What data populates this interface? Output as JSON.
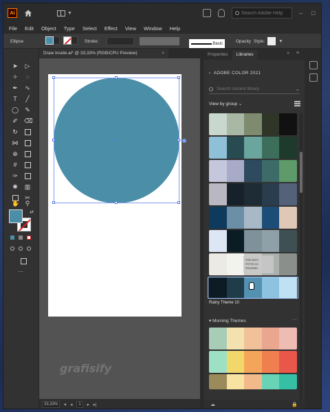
{
  "app": {
    "logo_text": "Ai"
  },
  "titlebar": {
    "search_placeholder": "Search Adobe Help"
  },
  "menu": [
    "File",
    "Edit",
    "Object",
    "Type",
    "Select",
    "Effect",
    "View",
    "Window",
    "Help"
  ],
  "controlbar": {
    "object_type": "Ellipse",
    "stroke_label": "Stroke:",
    "brush_label": "Basic",
    "opacity_label": "Opacity",
    "style_label": "Style:",
    "fill_color": "#4a8ea8"
  },
  "document": {
    "tab_title": "Draw Inside.ai* @ 33,33% (RGB/CPU Preview)",
    "close_glyph": "×"
  },
  "canvas": {
    "shape_color": "#4a8ea8",
    "watermark": "grafisify"
  },
  "statusbar": {
    "zoom": "33,33%",
    "artboard_number": "1"
  },
  "panel": {
    "tabs": [
      "Properties",
      "Libraries"
    ],
    "active_tab": "Libraries",
    "library_name": "ADOBE COLOR 2021",
    "search_placeholder": "Search current library",
    "view_by": "View by group",
    "themes": [
      {
        "colors": [
          "#c9d8cf",
          "#a8b8a5",
          "#7f8b6f",
          "#2f3527",
          "#111111"
        ]
      },
      {
        "colors": [
          "#8ec0d8",
          "#284b52",
          "#6aa69d",
          "#3d6e5c",
          "#1e3a2c"
        ]
      },
      {
        "colors": [
          "#c5c8dc",
          "#a7abc7",
          "#2d4a5f",
          "#3c6b68",
          "#5f9a6a"
        ]
      },
      {
        "colors": [
          "#b9b8c2",
          "#16212b",
          "#1e2c36",
          "#2a3d4e",
          "#53627a"
        ]
      },
      {
        "colors": [
          "#0e3a5d",
          "#6a8fa6",
          "#a7b8c7",
          "#1c4d78",
          "#e0c8b6"
        ]
      },
      {
        "colors": [
          "#dce6f4",
          "#0c1c25",
          "#7f919b",
          "#8fa0a8",
          "#3e5054"
        ]
      },
      {
        "colors": [
          "#eceae4",
          "#f2f2ee",
          "#c8c7c3",
          "#a9b0ad",
          "#8a8f8c"
        ]
      },
      {
        "colors": [
          "#0d1b24",
          "#1f3c4a",
          "#5490b0",
          "#8dc2e0",
          "#bfe1f3"
        ]
      }
    ],
    "highlighted_theme_label": "Rainy Theme 10",
    "tooltip_text": [
      "#0D1B24",
      "#1F3C4A",
      "#5490B0"
    ],
    "group2_title": "Morning Themes",
    "group2_themes": [
      {
        "colors": [
          "#a8cdb6",
          "#f3e2b0",
          "#f1c199",
          "#eba690",
          "#efbcb4"
        ]
      },
      {
        "colors": [
          "#9ee0c4",
          "#f2d76a",
          "#f5a55a",
          "#ef7f4f",
          "#e8574a"
        ]
      },
      {
        "colors": [
          "#9b8a5a",
          "#f9e3a3",
          "#f2b98a",
          "#68d4b5",
          "#36bfa4"
        ]
      }
    ]
  }
}
